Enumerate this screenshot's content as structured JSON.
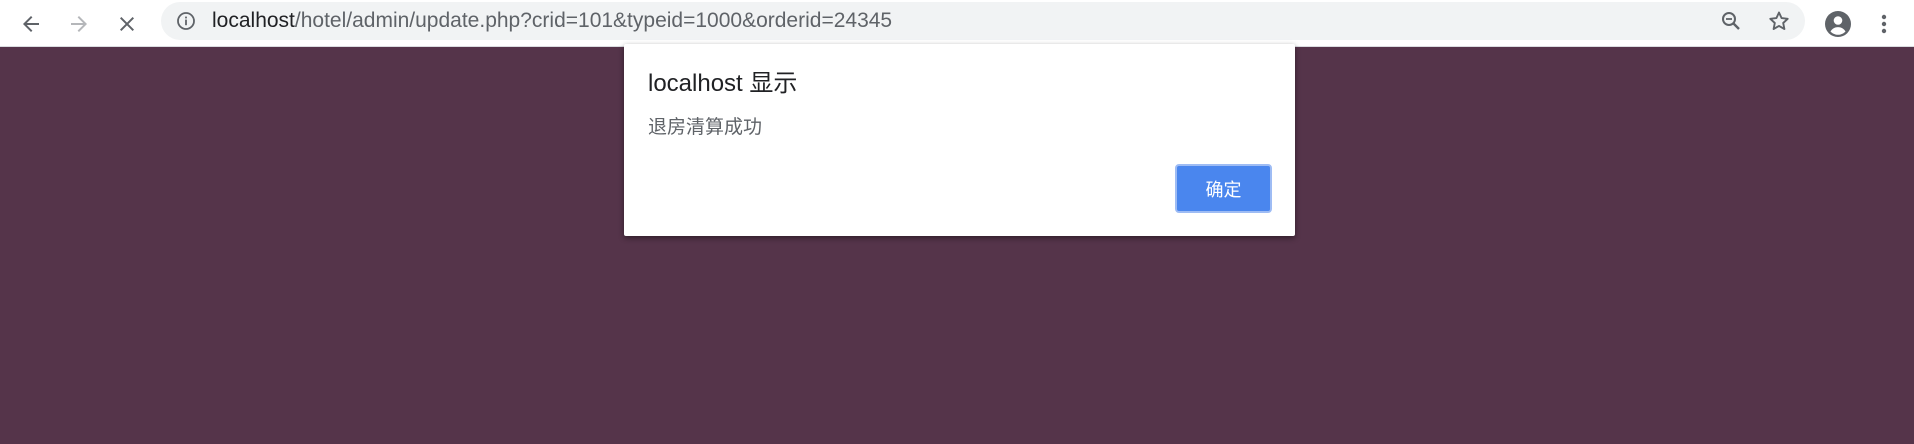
{
  "browser": {
    "url_host": "localhost",
    "url_path": "/hotel/admin/update.php?crid=101&typeid=1000&orderid=24345",
    "icons": {
      "back": "back-arrow-icon",
      "forward": "forward-arrow-icon",
      "stop": "close-icon",
      "site_info": "info-icon",
      "zoom": "zoom-out-icon",
      "bookmark": "star-icon",
      "profile": "account-icon",
      "menu": "more-vert-icon"
    }
  },
  "alert": {
    "title": "localhost 显示",
    "message": "退房清算成功",
    "ok_label": "确定"
  },
  "colors": {
    "page_background": "#55344a",
    "button_accent": "#4a86ee"
  }
}
